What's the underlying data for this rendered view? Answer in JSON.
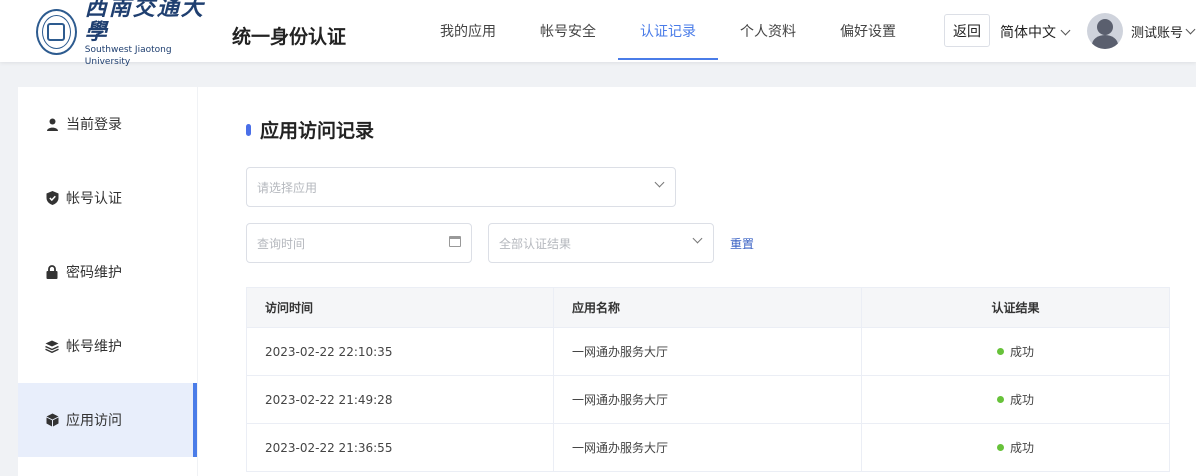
{
  "header": {
    "logo_cn": "西南交通大學",
    "logo_en": "Southwest Jiaotong University",
    "site_title": "统一身份认证",
    "nav": [
      "我的应用",
      "帐号安全",
      "认证记录",
      "个人资料",
      "偏好设置"
    ],
    "active_nav": "认证记录",
    "back_label": "返回",
    "language": "简体中文",
    "user_name": "测试账号"
  },
  "sidebar": {
    "items": [
      {
        "label": "当前登录",
        "icon": "user-icon"
      },
      {
        "label": "帐号认证",
        "icon": "shield-icon"
      },
      {
        "label": "密码维护",
        "icon": "lock-icon"
      },
      {
        "label": "帐号维护",
        "icon": "layers-icon"
      },
      {
        "label": "应用访问",
        "icon": "cube-icon"
      }
    ],
    "active": "应用访问"
  },
  "main": {
    "title": "应用访问记录",
    "app_select_placeholder": "请选择应用",
    "time_placeholder": "查询时间",
    "result_select_placeholder": "全部认证结果",
    "reset_label": "重置",
    "table": {
      "columns": [
        "访问时间",
        "应用名称",
        "认证结果"
      ],
      "rows": [
        {
          "time": "2023-02-22 22:10:35",
          "app": "一网通办服务大厅",
          "result": "成功"
        },
        {
          "time": "2023-02-22 21:49:28",
          "app": "一网通办服务大厅",
          "result": "成功"
        },
        {
          "time": "2023-02-22 21:36:55",
          "app": "一网通办服务大厅",
          "result": "成功"
        }
      ]
    }
  },
  "colors": {
    "accent": "#4a7ce8",
    "success": "#67c23a",
    "brand": "#1f3f70"
  }
}
